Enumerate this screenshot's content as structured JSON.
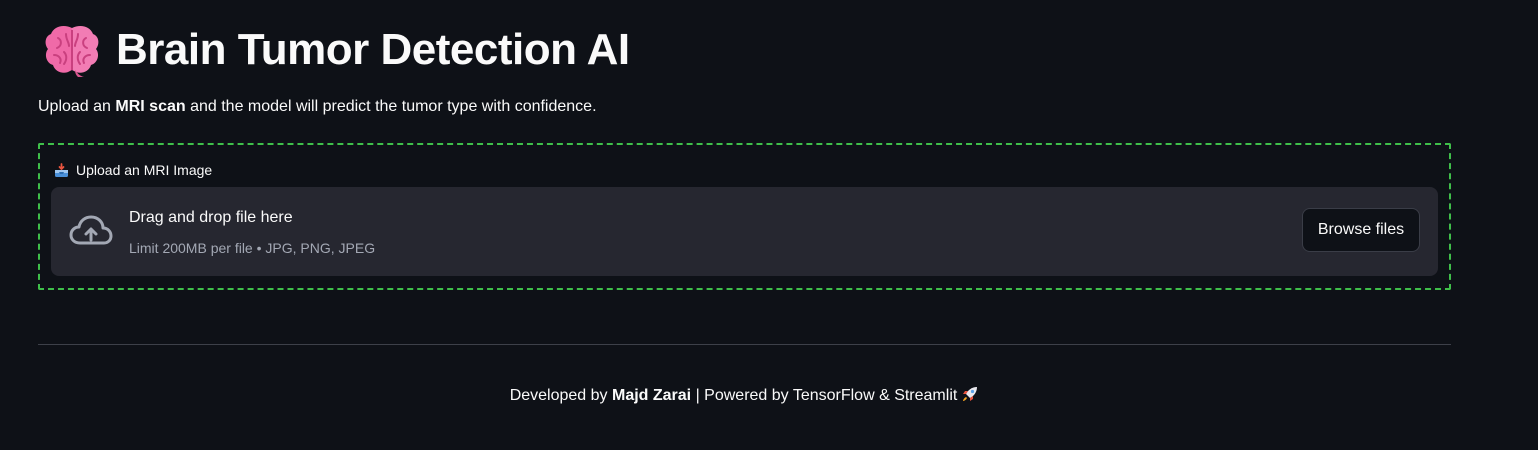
{
  "header": {
    "title": "Brain Tumor Detection AI",
    "icon": "brain-icon"
  },
  "intro": {
    "prefix": "Upload an ",
    "bold": "MRI scan",
    "suffix": " and the model will predict the tumor type with confidence."
  },
  "uploader": {
    "label": "Upload an MRI Image",
    "label_icon": "inbox-tray-icon",
    "drop_text": "Drag and drop file here",
    "hint": "Limit 200MB per file • JPG, PNG, JPEG",
    "browse_label": "Browse files",
    "border_color": "#3fbf4a"
  },
  "footer": {
    "prefix": "Developed by ",
    "author": "Majd Zarai",
    "separator": " | ",
    "suffix": "Powered by TensorFlow & Streamlit",
    "icon": "rocket-icon"
  },
  "colors": {
    "background": "#0e1117",
    "dropzone": "#262730",
    "text": "#fafafa",
    "muted": "#a3a8b4"
  }
}
